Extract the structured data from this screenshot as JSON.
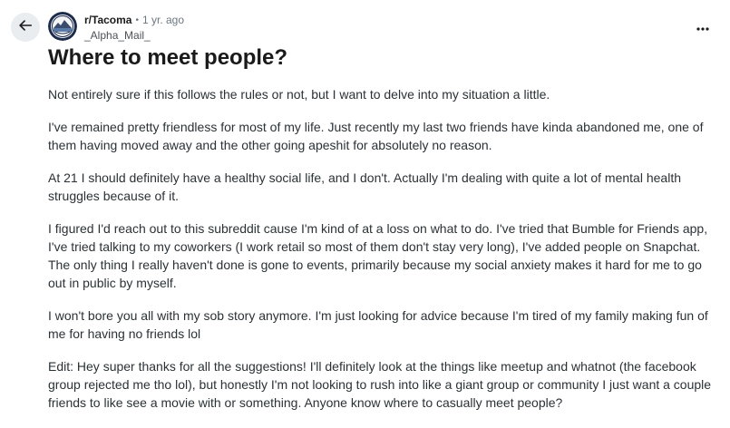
{
  "post": {
    "subreddit": "r/Tacoma",
    "separator": "•",
    "timestamp": "1 yr. ago",
    "author": "_Alpha_Mail_",
    "title": "Where to meet people?",
    "paragraphs": [
      "Not entirely sure if this follows the rules or not, but I want to delve into my situation a little.",
      "I've remained pretty friendless for most of my life. Just recently my last two friends have kinda abandoned me, one of them having moved away and the other going apeshit for absolutely no reason.",
      "At 21 I should definitely have a healthy social life, and I don't. Actually I'm dealing with quite a lot of mental health struggles because of it.",
      "I figured I'd reach out to this subreddit cause I'm kind of at a loss on what to do. I've tried that Bumble for Friends app, I've tried talking to my coworkers (I work retail so most of them don't stay very long), I've added people on Snapchat. The only thing I really haven't done is gone to events, primarily because my social anxiety makes it hard for me to go out in public by myself.",
      "I won't bore you all with my sob story anymore. I'm just looking for advice because I'm tired of my family making fun of me for having no friends lol",
      "Edit: Hey super thanks for all the suggestions! I'll definitely look at the things like meetup and whatnot (the facebook group rejected me tho lol), but honestly I'm not looking to rush into like a giant group or community I just want a couple friends to like see a movie with or something. Anyone know where to casually meet people?"
    ]
  },
  "icons": {
    "back": "arrow-left-icon",
    "more": "ellipsis-horizontal-icon",
    "avatar": "subreddit-avatar"
  },
  "colors": {
    "text": "#1a1a1b",
    "body_text": "#2a3236",
    "meta_text": "#6b7780",
    "back_button_bg": "#e9edf0",
    "avatar_ring": "#1c2b4a"
  }
}
